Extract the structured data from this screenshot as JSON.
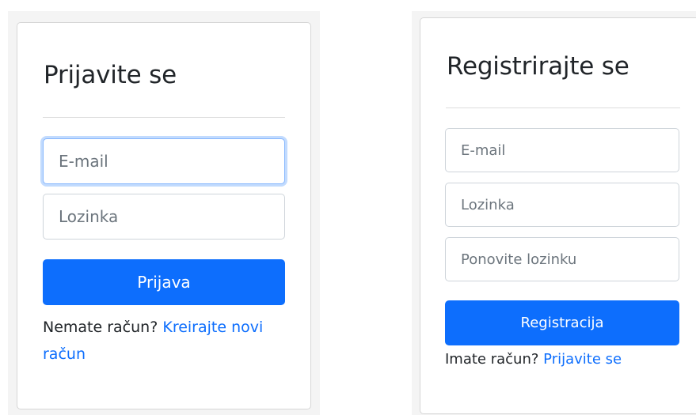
{
  "login": {
    "title": "Prijavite se",
    "email_placeholder": "E-mail",
    "password_placeholder": "Lozinka",
    "submit_label": "Prijava",
    "footer_text": "Nemate račun?",
    "footer_link": "Kreirajte novi račun"
  },
  "register": {
    "title": "Registrirajte se",
    "email_placeholder": "E-mail",
    "password_placeholder": "Lozinka",
    "repeat_password_placeholder": "Ponovite lozinku",
    "submit_label": "Registracija",
    "footer_text": "Imate račun?",
    "footer_link": "Prijavite se"
  },
  "colors": {
    "primary": "#0d6efd",
    "focus_border": "#86b7fe",
    "panel_background": "#f4f4f4",
    "card_border": "#d6d6d6"
  }
}
